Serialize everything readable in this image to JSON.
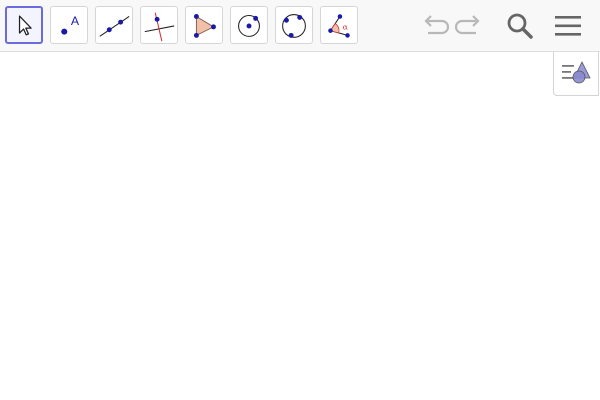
{
  "toolbar": {
    "tools": [
      {
        "name": "move-tool",
        "icon": "arrow-pointer-icon",
        "selected": true
      },
      {
        "name": "point-tool",
        "icon": "point-icon",
        "label": "A",
        "selected": false
      },
      {
        "name": "line-tool",
        "icon": "line-through-two-points-icon",
        "selected": false
      },
      {
        "name": "perpendicular-line-tool",
        "icon": "perpendicular-line-icon",
        "selected": false
      },
      {
        "name": "polygon-tool",
        "icon": "polygon-icon",
        "selected": false
      },
      {
        "name": "circle-center-point-tool",
        "icon": "circle-center-point-icon",
        "selected": false
      },
      {
        "name": "circle-three-points-tool",
        "icon": "circle-three-points-icon",
        "selected": false
      },
      {
        "name": "angle-tool",
        "icon": "angle-icon",
        "label": "α",
        "selected": false
      }
    ],
    "actions": [
      {
        "name": "undo-button",
        "icon": "undo-icon"
      },
      {
        "name": "redo-button",
        "icon": "redo-icon"
      },
      {
        "name": "search-button",
        "icon": "search-icon"
      },
      {
        "name": "menu-button",
        "icon": "hamburger-menu-icon"
      }
    ]
  },
  "style_bar": {
    "icon": "style-bar-toggle-icon"
  },
  "colors": {
    "selected_border": "#6b6be0",
    "point_blue": "#1a1aa8",
    "red": "#d32f2f",
    "polygon_fill": "#f0c0a8",
    "icon_gray": "#666666"
  }
}
